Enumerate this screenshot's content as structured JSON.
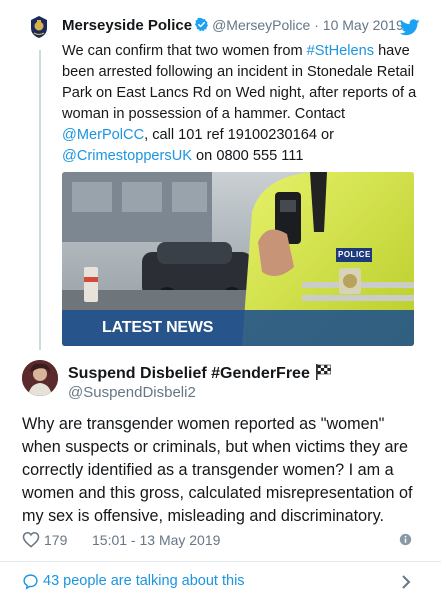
{
  "quoted_tweet": {
    "author_name": "Merseyside Police",
    "handle": "@MerseyPolice",
    "separator": " · ",
    "date": "10 May 2019",
    "text_parts": [
      {
        "text": "We can confirm that two women from ",
        "type": "text"
      },
      {
        "text": "#StHelens",
        "type": "link"
      },
      {
        "text": " have been arrested following an incident in Stonedale Retail Park on East Lancs Rd on Wed night, after reports of a woman in possession of a hammer. Contact ",
        "type": "text"
      },
      {
        "text": "@MerPolCC",
        "type": "link"
      },
      {
        "text": ", call 101 ref 19100230164 or ",
        "type": "text"
      },
      {
        "text": "@CrimestoppersUK",
        "type": "link"
      },
      {
        "text": " on 0800 555 111",
        "type": "text"
      }
    ],
    "image": {
      "banner": "LATEST NEWS",
      "badge_text": "POLICE"
    },
    "icons": {
      "verified": "verified-badge-icon",
      "bird": "twitter-bird-icon"
    }
  },
  "tweet": {
    "author_name": "Suspend Disbelief #GenderFree",
    "handle": "@SuspendDisbeli2",
    "text": "Why are transgender women reported as \"women\" when suspects or criminals, but when victims they are correctly identified as a transgender women? I am a women and this gross, calculated misrepresentation of my sex is offensive, misleading and discriminatory.",
    "likes": "179",
    "timestamp": "15:01 - 13 May 2019",
    "icons": {
      "flag": "checkered-flag-icon",
      "heart": "heart-icon",
      "info": "info-icon"
    }
  },
  "footer": {
    "talking_text": "43 people are talking about this",
    "icons": {
      "bubble": "speech-bubble-icon",
      "chevron": "chevron-right-icon"
    }
  },
  "colors": {
    "link": "#1b95e0",
    "secondary_text": "#657786",
    "verified": "#1da1f2",
    "news_bar": "#1e508c"
  }
}
